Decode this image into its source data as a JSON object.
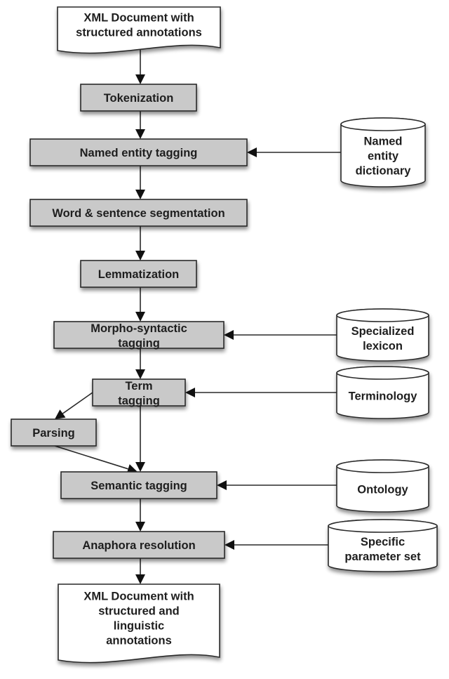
{
  "diagram": {
    "type": "flowchart",
    "colors": {
      "process_fill": "#c9c9c9",
      "store_fill": "#ffffff",
      "stroke": "#2a2a2a"
    },
    "nodes": {
      "input_doc": {
        "kind": "document",
        "lines": [
          "XML Document with",
          "structured annotations"
        ]
      },
      "tokenization": {
        "kind": "process",
        "lines": [
          "Tokenization"
        ]
      },
      "ne_tagging": {
        "kind": "process",
        "lines": [
          "Named entity tagging"
        ]
      },
      "segmentation": {
        "kind": "process",
        "lines": [
          "Word & sentence segmentation"
        ]
      },
      "lemmatization": {
        "kind": "process",
        "lines": [
          "Lemmatization"
        ]
      },
      "morpho": {
        "kind": "process",
        "lines": [
          "Morpho-syntactic",
          "tagging"
        ]
      },
      "term_tagging": {
        "kind": "process",
        "lines": [
          "Term",
          "tagging"
        ]
      },
      "parsing": {
        "kind": "process",
        "lines": [
          "Parsing"
        ]
      },
      "semantic": {
        "kind": "process",
        "lines": [
          "Semantic tagging"
        ]
      },
      "anaphora": {
        "kind": "process",
        "lines": [
          "Anaphora resolution"
        ]
      },
      "output_doc": {
        "kind": "document",
        "lines": [
          "XML Document with",
          "structured and",
          "linguistic",
          "annotations"
        ]
      },
      "ne_dict": {
        "kind": "datastore",
        "lines": [
          "Named",
          "entity",
          "dictionary"
        ]
      },
      "lexicon": {
        "kind": "datastore",
        "lines": [
          "Specialized",
          "lexicon"
        ]
      },
      "terminology": {
        "kind": "datastore",
        "lines": [
          "Terminology"
        ]
      },
      "ontology": {
        "kind": "datastore",
        "lines": [
          "Ontology"
        ]
      },
      "params": {
        "kind": "datastore",
        "lines": [
          "Specific",
          "parameter set"
        ]
      }
    },
    "edges": [
      {
        "from": "input_doc",
        "to": "tokenization"
      },
      {
        "from": "tokenization",
        "to": "ne_tagging"
      },
      {
        "from": "ne_tagging",
        "to": "segmentation"
      },
      {
        "from": "segmentation",
        "to": "lemmatization"
      },
      {
        "from": "lemmatization",
        "to": "morpho"
      },
      {
        "from": "morpho",
        "to": "term_tagging"
      },
      {
        "from": "term_tagging",
        "to": "parsing"
      },
      {
        "from": "term_tagging",
        "to": "semantic"
      },
      {
        "from": "parsing",
        "to": "semantic"
      },
      {
        "from": "semantic",
        "to": "anaphora"
      },
      {
        "from": "anaphora",
        "to": "output_doc"
      },
      {
        "from": "ne_dict",
        "to": "ne_tagging"
      },
      {
        "from": "lexicon",
        "to": "morpho"
      },
      {
        "from": "terminology",
        "to": "term_tagging"
      },
      {
        "from": "ontology",
        "to": "semantic"
      },
      {
        "from": "params",
        "to": "anaphora"
      }
    ]
  }
}
